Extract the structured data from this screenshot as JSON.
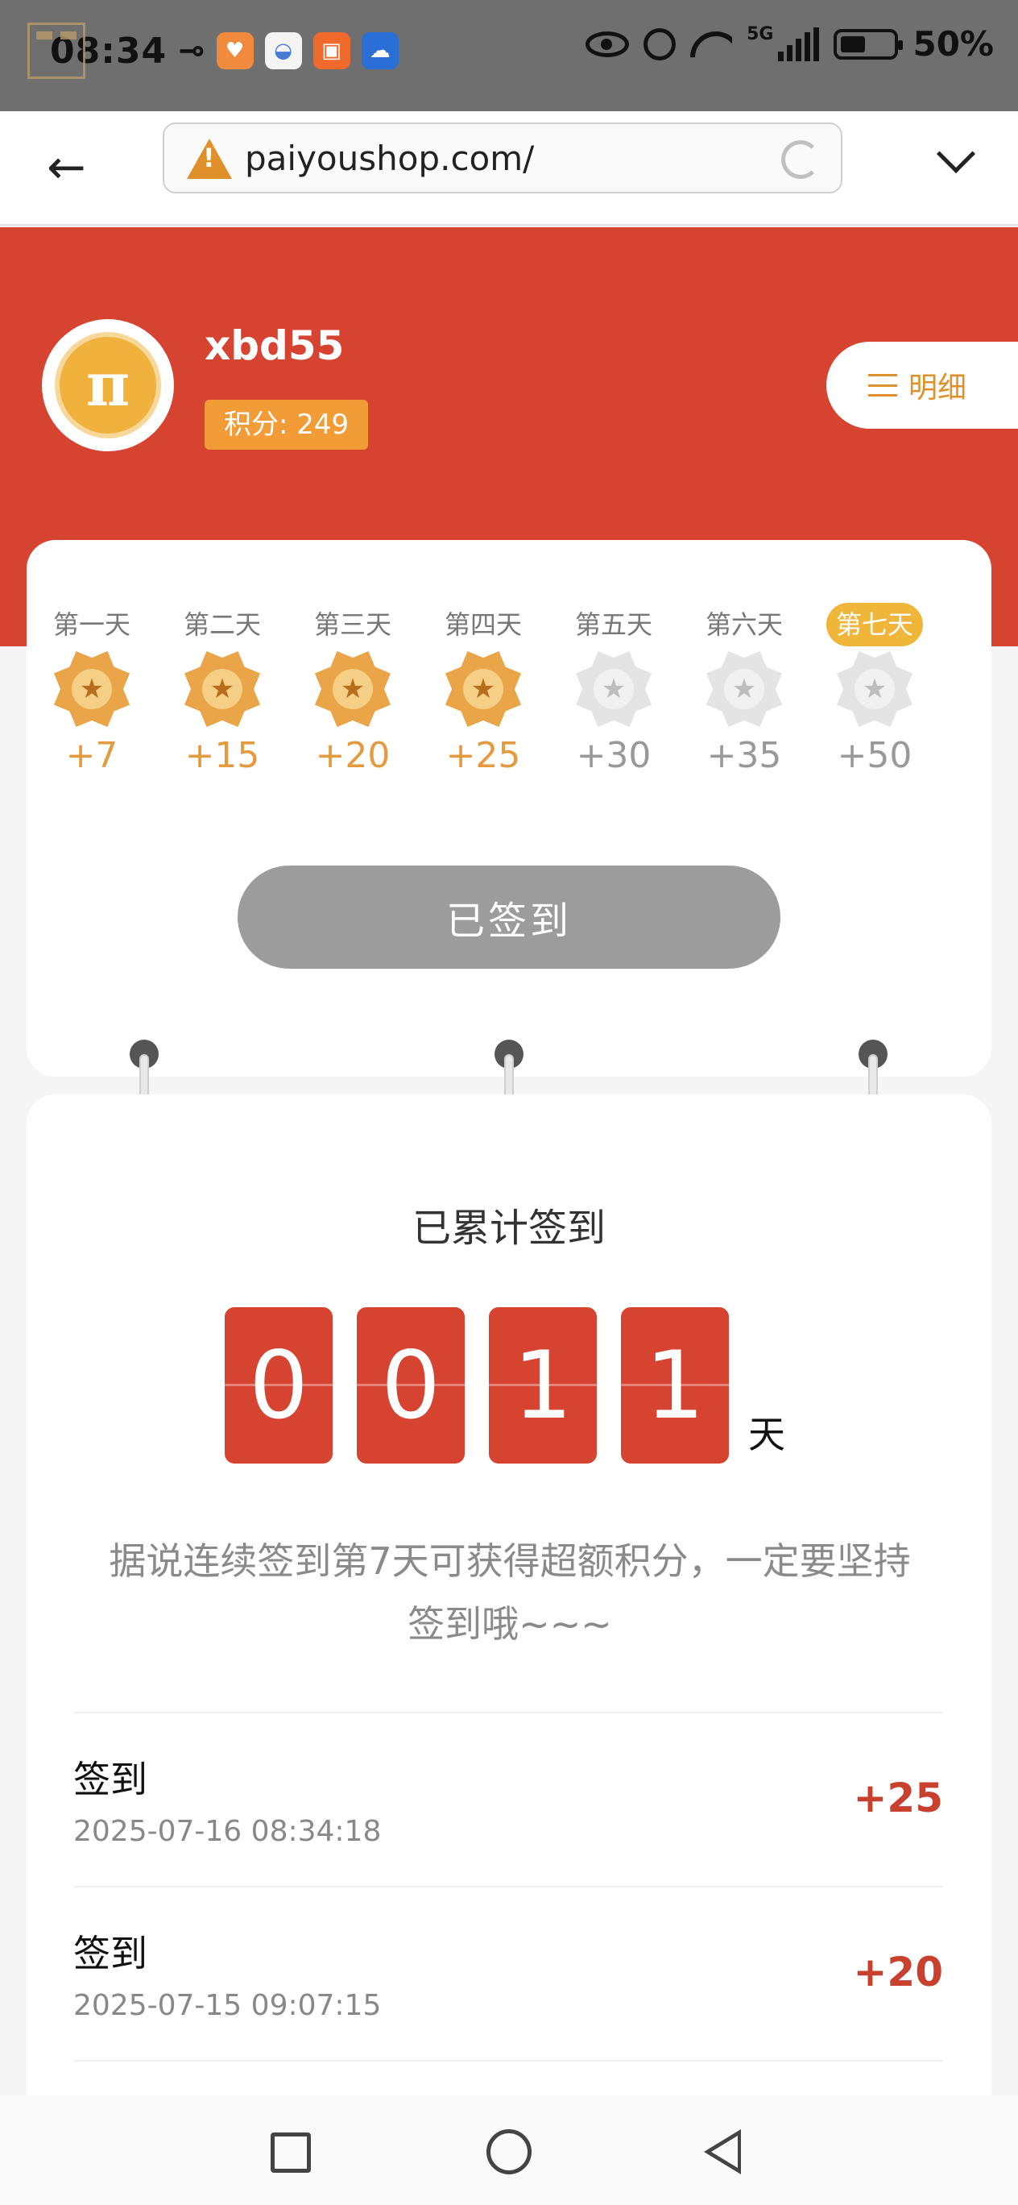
{
  "status_bar": {
    "time": "08:34",
    "network": "5G",
    "battery": "50%",
    "icons": [
      "castle-icon",
      "key-icon",
      "app-heart-icon",
      "app-whale-icon",
      "app-redpacket-icon",
      "app-cloud-icon",
      "eye-icon",
      "alarm-icon",
      "wifi-icon",
      "signal-icon",
      "battery-icon"
    ]
  },
  "browser": {
    "url": "paiyoushop.com/",
    "icons": [
      "back-arrow-icon",
      "warning-icon",
      "reload-icon",
      "chevron-down-icon"
    ]
  },
  "user": {
    "name": "xbd55",
    "points_label": "积分: 249",
    "avatar_glyph": "π",
    "detail_label": "明细"
  },
  "signin": {
    "days": [
      {
        "label": "第一天",
        "reward": "+7",
        "done": true
      },
      {
        "label": "第二天",
        "reward": "+15",
        "done": true
      },
      {
        "label": "第三天",
        "reward": "+20",
        "done": true
      },
      {
        "label": "第四天",
        "reward": "+25",
        "done": true
      },
      {
        "label": "第五天",
        "reward": "+30",
        "done": false
      },
      {
        "label": "第六天",
        "reward": "+35",
        "done": false
      },
      {
        "label": "第七天",
        "reward": "+50",
        "done": false,
        "highlight": true
      }
    ],
    "button_label": "已签到"
  },
  "counter": {
    "title": "已累计签到",
    "digits": [
      "0",
      "0",
      "1",
      "1"
    ],
    "unit": "天",
    "tip": "据说连续签到第7天可获得超额积分，一定要坚持签到哦~~~"
  },
  "records": [
    {
      "title": "签到",
      "time": "2025-07-16 08:34:18",
      "points": "+25"
    },
    {
      "title": "签到",
      "time": "2025-07-15 09:07:15",
      "points": "+20"
    }
  ],
  "colors": {
    "brand_red": "#d64331",
    "gold": "#e9a548",
    "orange_badge": "#f29c38",
    "button_gray": "#9c9c9c"
  }
}
